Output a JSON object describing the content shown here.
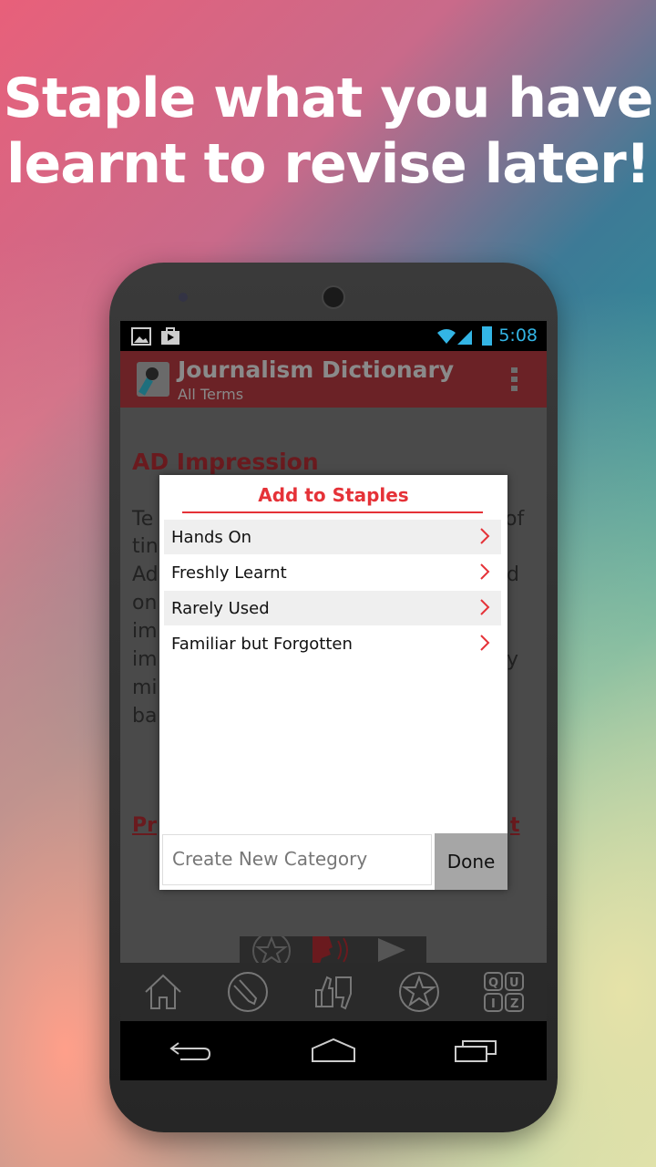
{
  "headline": [
    "Staple what you have",
    "learnt to revise later!"
  ],
  "status_bar": {
    "time": "5:08"
  },
  "action_bar": {
    "title": "Journalism Dictionary",
    "subtitle": "All Terms"
  },
  "content": {
    "term": "AD Impression",
    "fragments": [
      "Te",
      "of",
      "tin",
      "Ad",
      "d",
      "on",
      "im",
      "im",
      "y",
      "mi",
      "ba",
      "Pr",
      "t"
    ]
  },
  "dialog": {
    "title": "Add to Staples",
    "items": [
      "Hands On",
      "Freshly Learnt",
      "Rarely Used",
      "Familiar but Forgotten"
    ],
    "input_placeholder": "Create New Category",
    "done_label": "Done"
  },
  "tabs": [
    "home-icon",
    "pen-icon",
    "thumbs-icon",
    "star-icon",
    "quiz-icon"
  ],
  "colors": {
    "accent": "#e53238",
    "status_blue": "#33b5e5"
  }
}
